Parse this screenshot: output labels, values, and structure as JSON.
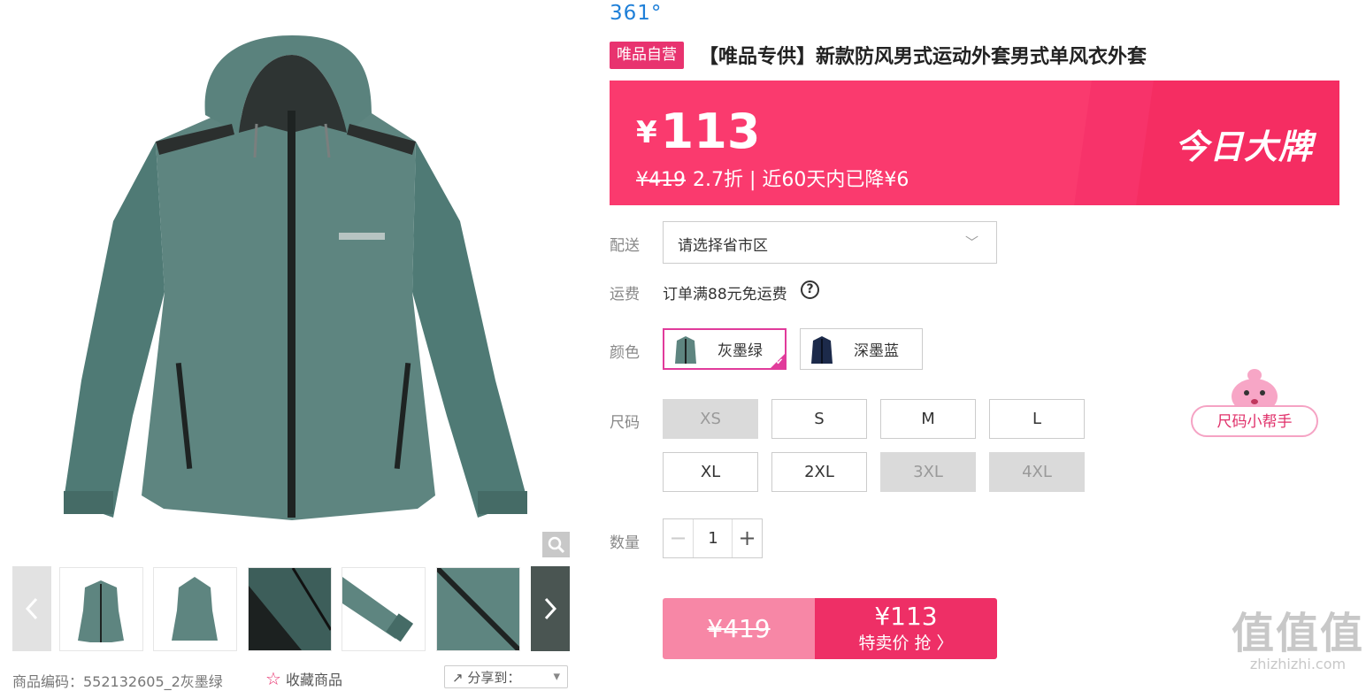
{
  "gallery": {
    "main_image_alt": "",
    "thumb_count": 5,
    "meta": "商品编码：552132605_2灰墨绿",
    "favorite_label": "收藏商品",
    "share_label": "分享到："
  },
  "product": {
    "brand": "361°",
    "badge": "唯品自营",
    "title": "【唯品专供】新款防风男式运动外套男式单风衣外套"
  },
  "price": {
    "symbol": "¥",
    "current": "113",
    "original": "¥419",
    "discount_note": "2.7折 | 近60天内已降¥6",
    "banner_label": "今日大牌"
  },
  "delivery": {
    "label": "配送",
    "placeholder": "请选择省市区"
  },
  "shipping": {
    "label": "运费",
    "text": "订单满88元免运费"
  },
  "colors": {
    "label": "颜色",
    "options": [
      {
        "name": "灰墨绿",
        "selected": true,
        "swatch": "#5e8580"
      },
      {
        "name": "深墨蓝",
        "selected": false,
        "swatch": "#1c2a4a"
      }
    ]
  },
  "sizes": {
    "label": "尺码",
    "options": [
      {
        "name": "XS",
        "available": false
      },
      {
        "name": "S",
        "available": true
      },
      {
        "name": "M",
        "available": true
      },
      {
        "name": "L",
        "available": true
      },
      {
        "name": "XL",
        "available": true
      },
      {
        "name": "2XL",
        "available": true
      },
      {
        "name": "3XL",
        "available": false
      },
      {
        "name": "4XL",
        "available": false
      }
    ]
  },
  "quantity": {
    "label": "数量",
    "value": "1",
    "minus": "−",
    "plus": "+"
  },
  "buy": {
    "original": "¥419",
    "price": "¥113",
    "action": "特卖价 抢 〉"
  },
  "size_helper": {
    "label": "尺码小帮手"
  },
  "watermark": {
    "big": "值值值",
    "small": "zhizhizhi.com"
  },
  "colors_theme": {
    "accent": "#f52d62",
    "brand_blue": "#1e7fd8",
    "select_border": "#e13b9b"
  }
}
